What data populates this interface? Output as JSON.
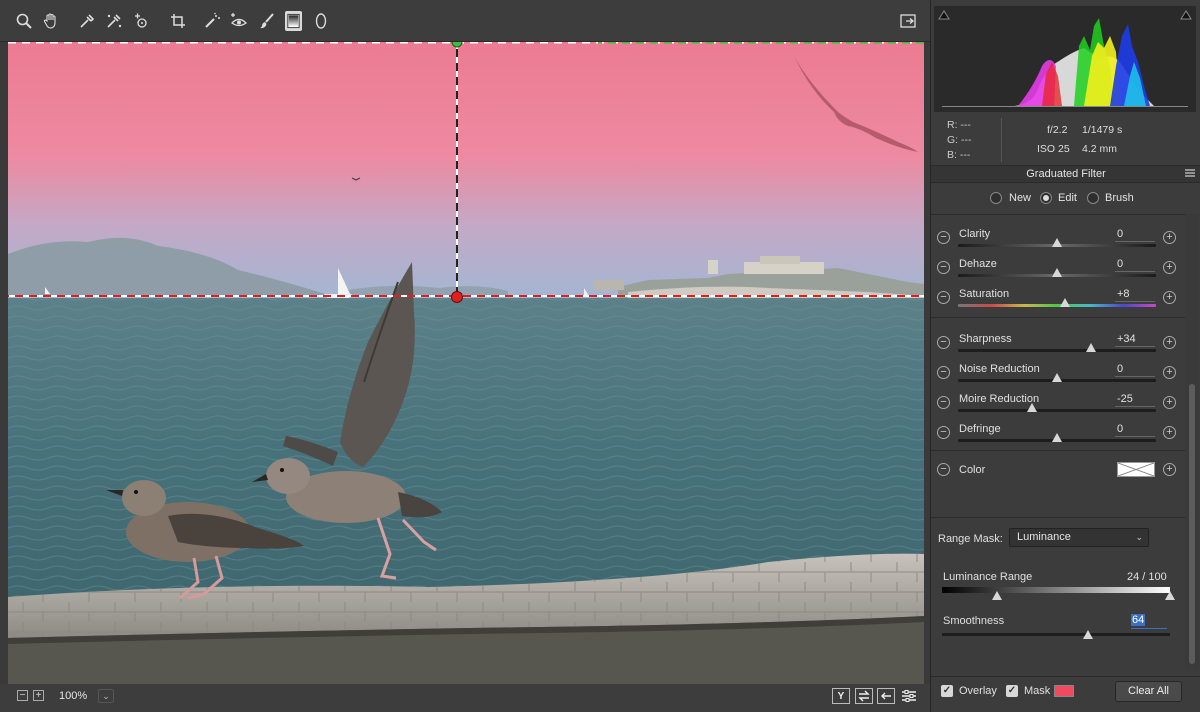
{
  "toolbar": {
    "tools": [
      "zoom-icon",
      "hand-icon",
      "white-balance-icon",
      "color-sampler-icon",
      "targeted-adjustment-icon",
      "crop-icon",
      "spot-removal-icon",
      "red-eye-icon",
      "adjustment-brush-icon",
      "graduated-filter-icon",
      "radial-filter-icon"
    ],
    "active_tool": "graduated-filter-icon"
  },
  "bottom_bar": {
    "zoom_value": "100%",
    "zoom_out": "−",
    "zoom_in": "+",
    "dropdown_chevron": "⌄",
    "compare_label": "Y"
  },
  "histogram": {
    "readout": {
      "r": "R:   ---",
      "g": "G:   ---",
      "b": "B:   ---"
    },
    "exif": {
      "aperture": "f/2.2",
      "shutter": "1/1479 s",
      "iso": "ISO 25",
      "focal": "4.2 mm"
    }
  },
  "section": {
    "title": "Graduated Filter",
    "modes": [
      "New",
      "Edit",
      "Brush"
    ],
    "selected_mode": "Edit"
  },
  "sliders": [
    {
      "label": "Clarity",
      "value": "0",
      "level": 0
    },
    {
      "label": "Dehaze",
      "value": "0",
      "level": 0
    },
    {
      "label": "Saturation",
      "value": "+8",
      "level": 8
    },
    {
      "label": "Sharpness",
      "value": "+34",
      "level": 34
    },
    {
      "label": "Noise Reduction",
      "value": "0",
      "level": 0
    },
    {
      "label": "Moire Reduction",
      "value": "-25",
      "level": -25
    },
    {
      "label": "Defringe",
      "value": "0",
      "level": 0
    }
  ],
  "color": {
    "label": "Color"
  },
  "range_mask": {
    "label": "Range Mask:",
    "selected": "Luminance",
    "range_label": "Luminance Range",
    "range_value": "24 / 100",
    "range_low": 24,
    "range_high": 100,
    "smoothness_label": "Smoothness",
    "smoothness_value": "64",
    "smoothness_level": 64
  },
  "footer": {
    "overlay_label": "Overlay",
    "mask_label": "Mask",
    "mask_color": "#f04a60",
    "clear_all": "Clear All"
  },
  "colors": {
    "accent": "#3b6fc4",
    "mask_overlay": "#f06680",
    "guide_green": "#3fbf3f",
    "guide_red": "#e02020"
  }
}
